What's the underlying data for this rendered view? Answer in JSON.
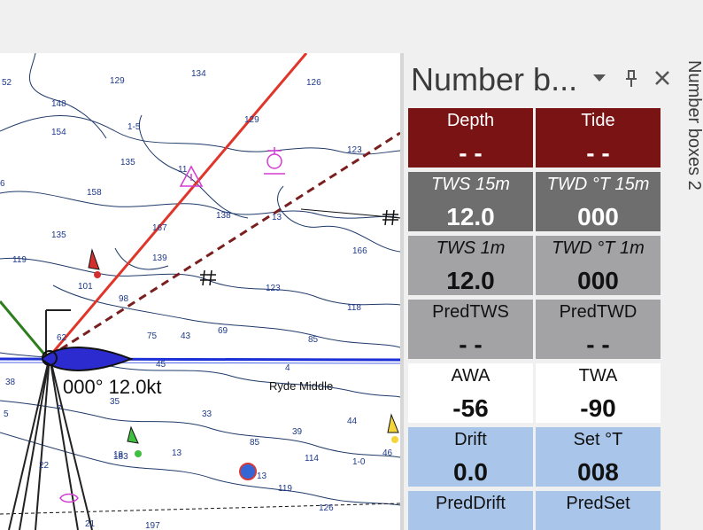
{
  "panel": {
    "title": "Number b...",
    "side_tab_label": "Number boxes 2",
    "boxes": [
      {
        "label": "Depth",
        "value": "- -",
        "color": "#7a1414"
      },
      {
        "label": "Tide",
        "value": "- -",
        "color": "#7a1414"
      },
      {
        "label": "TWS 15m",
        "value": "12.0",
        "color": "#6e6e6e"
      },
      {
        "label": "TWD °T 15m",
        "value": "000",
        "color": "#6e6e6e"
      },
      {
        "label": "TWS 1m",
        "value": "12.0",
        "color": "#a3a3a6"
      },
      {
        "label": "TWD °T 1m",
        "value": "000",
        "color": "#a3a3a6"
      },
      {
        "label": "PredTWS",
        "value": "- -",
        "color": "#a3a3a6"
      },
      {
        "label": "PredTWD",
        "value": "- -",
        "color": "#a3a3a6"
      },
      {
        "label": "AWA",
        "value": "-56",
        "color": "#ffffff"
      },
      {
        "label": "TWA",
        "value": "-90",
        "color": "#ffffff"
      },
      {
        "label": "Drift",
        "value": "0.0",
        "color": "#a9c6ea"
      },
      {
        "label": "Set °T",
        "value": "008",
        "color": "#a9c6ea"
      },
      {
        "label": "PredDrift",
        "value": "",
        "color": "#a9c6ea"
      },
      {
        "label": "PredSet",
        "value": "",
        "color": "#a9c6ea"
      }
    ]
  },
  "chart": {
    "boat_readout": "000° 12.0kt",
    "place_name": "Ryde Middle",
    "soundings": [
      "52",
      "129",
      "134",
      "126",
      "148",
      "1-5",
      "154",
      "129",
      "135",
      "11",
      "123",
      "6",
      "158",
      "138",
      "13",
      "135",
      "167",
      "166",
      "119",
      "139",
      "101",
      "98",
      "123",
      "118",
      "62",
      "75",
      "43",
      "69",
      "85",
      "38",
      "45",
      "4",
      "33",
      "35",
      "7",
      "5",
      "44",
      "18",
      "13",
      "85",
      "39",
      "114",
      "46",
      "22",
      "13",
      "119",
      "183",
      "126",
      "21",
      "197",
      "1-0"
    ]
  }
}
